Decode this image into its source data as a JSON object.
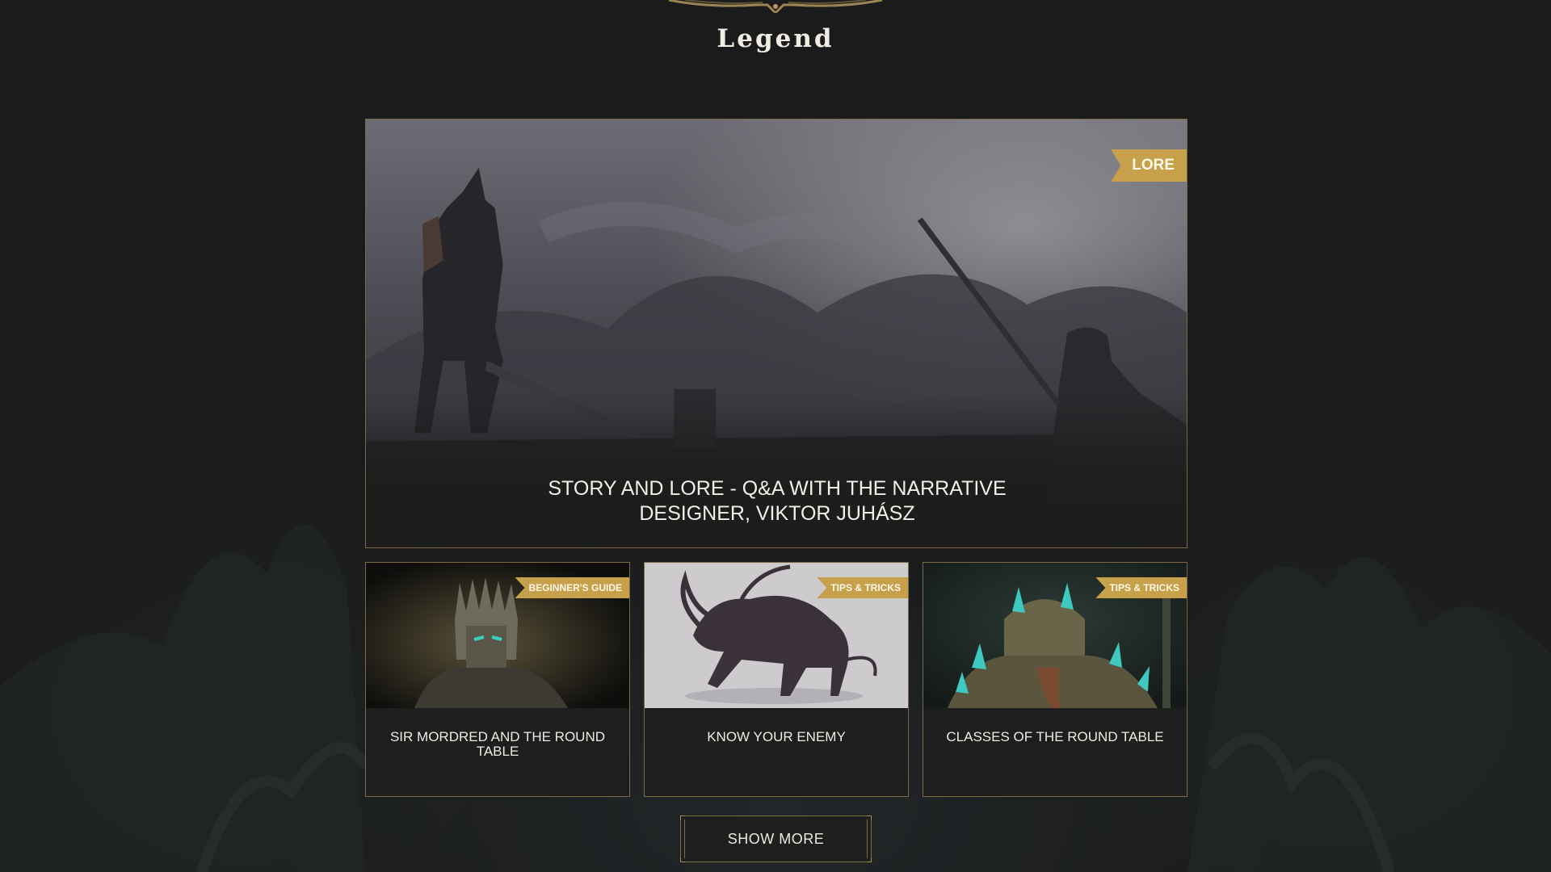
{
  "page": {
    "title": "Legend"
  },
  "featured": {
    "tag": "LORE",
    "title": "STORY AND LORE - Q&A WITH THE NARRATIVE DESIGNER, VIKTOR JUHÁSZ"
  },
  "cards": [
    {
      "tag": "BEGINNER'S GUIDE",
      "title": "SIR MORDRED AND THE ROUND TABLE"
    },
    {
      "tag": "TIPS & TRICKS",
      "title": "KNOW YOUR ENEMY"
    },
    {
      "tag": "TIPS & TRICKS",
      "title": "CLASSES OF THE ROUND TABLE"
    }
  ],
  "show_more": {
    "label": "SHOW MORE"
  },
  "colors": {
    "background": "#1b1b1b",
    "accent_gold": "#c6a04a",
    "border_gold": "#7a6a45",
    "text": "#ece8dc"
  },
  "icons": {
    "header_ornament": "gold-ornament-icon"
  }
}
